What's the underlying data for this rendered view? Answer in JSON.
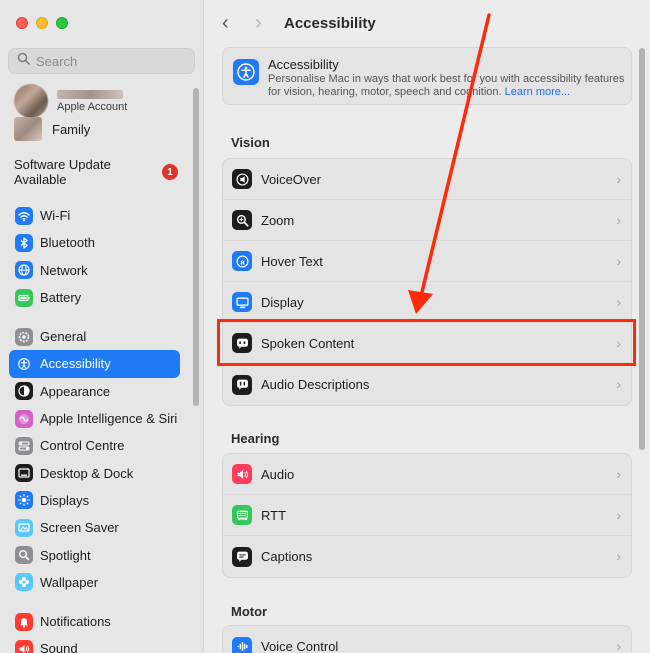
{
  "sidebar": {
    "search_placeholder": "Search",
    "account_sub": "Apple Account",
    "family_label": "Family",
    "software_update_line1": "Software Update",
    "software_update_line2": "Available",
    "update_badge": "1",
    "groups": [
      [
        {
          "label": "Wi-Fi",
          "icon": "wifi-icon",
          "color": "#1f7af6"
        },
        {
          "label": "Bluetooth",
          "icon": "bluetooth-icon",
          "color": "#1f7af6"
        },
        {
          "label": "Network",
          "icon": "globe-icon",
          "color": "#1f7af6"
        },
        {
          "label": "Battery",
          "icon": "battery-icon",
          "color": "#34c759"
        }
      ],
      [
        {
          "label": "General",
          "icon": "gear-icon",
          "color": "#8e8e93"
        },
        {
          "label": "Accessibility",
          "icon": "accessibility-icon",
          "color": "#1f7af6",
          "active": true
        },
        {
          "label": "Appearance",
          "icon": "appearance-icon",
          "color": "#1d1d1f"
        },
        {
          "label": "Apple Intelligence & Siri",
          "icon": "siri-icon",
          "color": "#d860c8"
        },
        {
          "label": "Control Centre",
          "icon": "control-centre-icon",
          "color": "#8e8e93"
        },
        {
          "label": "Desktop & Dock",
          "icon": "dock-icon",
          "color": "#1d1d1f"
        },
        {
          "label": "Displays",
          "icon": "sun-icon",
          "color": "#1f7af6"
        },
        {
          "label": "Screen Saver",
          "icon": "screen-saver-icon",
          "color": "#5ac8fa"
        },
        {
          "label": "Spotlight",
          "icon": "magnifier-icon",
          "color": "#8e8e93"
        },
        {
          "label": "Wallpaper",
          "icon": "flower-icon",
          "color": "#5ac8fa"
        }
      ],
      [
        {
          "label": "Notifications",
          "icon": "bell-icon",
          "color": "#ff3b30"
        },
        {
          "label": "Sound",
          "icon": "speaker-icon",
          "color": "#ff3b30"
        }
      ]
    ]
  },
  "main": {
    "title": "Accessibility",
    "header_card": {
      "title": "Accessibility",
      "description": "Personalise Mac in ways that work best for you with accessibility features for vision, hearing, motor, speech and cognition.",
      "link": "Learn more..."
    },
    "sections": [
      {
        "label": "Vision",
        "rows": [
          {
            "label": "VoiceOver",
            "icon": "voiceover-icon"
          },
          {
            "label": "Zoom",
            "icon": "zoom-icon"
          },
          {
            "label": "Hover Text",
            "icon": "hover-text-icon"
          },
          {
            "label": "Display",
            "icon": "display-icon"
          },
          {
            "label": "Spoken Content",
            "icon": "spoken-content-icon"
          },
          {
            "label": "Audio Descriptions",
            "icon": "audio-descriptions-icon"
          }
        ]
      },
      {
        "label": "Hearing",
        "rows": [
          {
            "label": "Audio",
            "icon": "audio-icon"
          },
          {
            "label": "RTT",
            "icon": "rtt-icon"
          },
          {
            "label": "Captions",
            "icon": "captions-icon"
          }
        ]
      },
      {
        "label": "Motor",
        "rows": [
          {
            "label": "Voice Control",
            "icon": "voice-control-icon"
          }
        ]
      }
    ]
  },
  "colors": {
    "accent": "#1f7af6",
    "annotation": "#ff2a0a",
    "badge": "#e0332c"
  }
}
